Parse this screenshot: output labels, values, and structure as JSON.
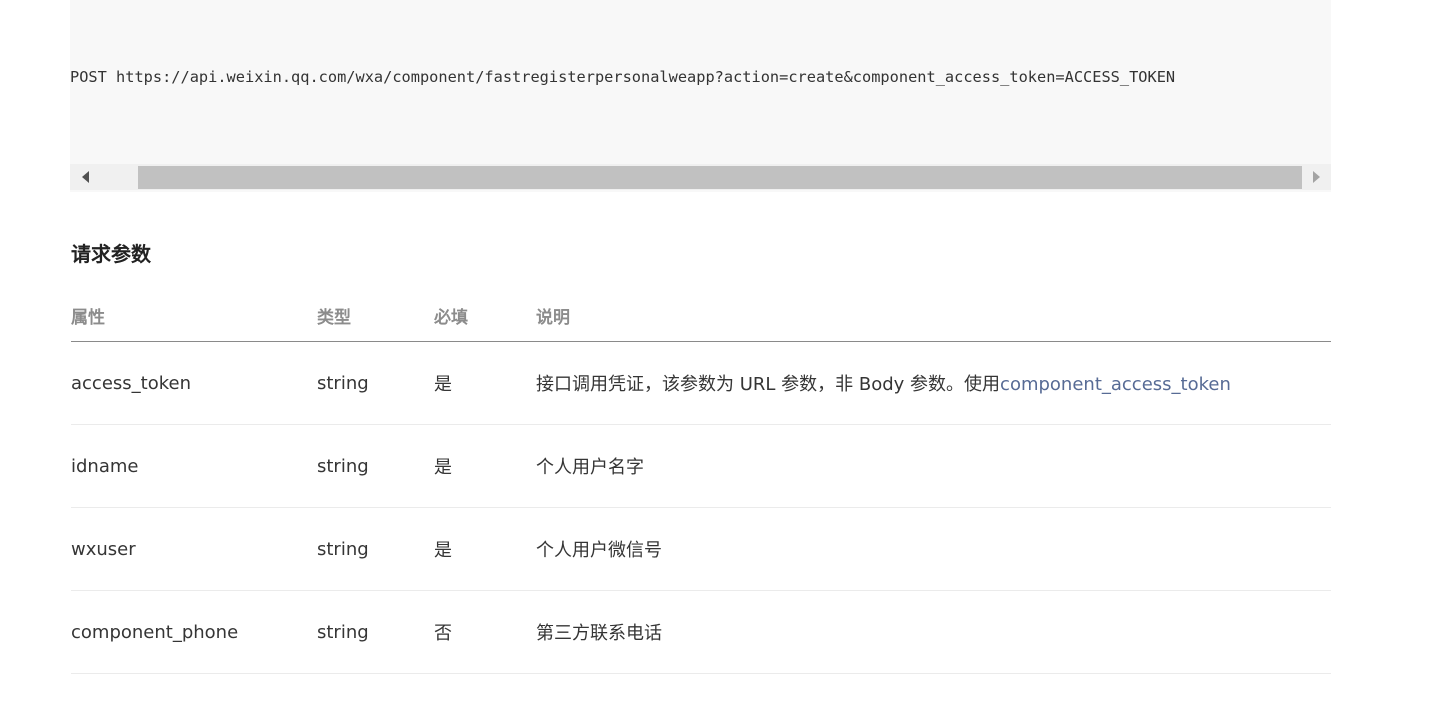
{
  "code": {
    "request_line": "POST https://api.weixin.qq.com/wxa/component/fastregisterpersonalweapp?action=create&component_access_token=ACCESS_TOKEN"
  },
  "section": {
    "title": "请求参数"
  },
  "table": {
    "headers": {
      "property": "属性",
      "type": "类型",
      "required": "必填",
      "description": "说明"
    },
    "rows": [
      {
        "property": "access_token",
        "type": "string",
        "required": "是",
        "description": "接口调用凭证，该参数为 URL 参数，非 Body 参数。使用",
        "description_link": "component_access_token"
      },
      {
        "property": "idname",
        "type": "string",
        "required": "是",
        "description": "个人用户名字"
      },
      {
        "property": "wxuser",
        "type": "string",
        "required": "是",
        "description": "个人用户微信号"
      },
      {
        "property": "component_phone",
        "type": "string",
        "required": "否",
        "description": "第三方联系电话"
      }
    ]
  },
  "colors": {
    "link": "#576b95",
    "code_background": "#f8f8f8",
    "scrollbar_thumb": "#c1c1c1"
  }
}
